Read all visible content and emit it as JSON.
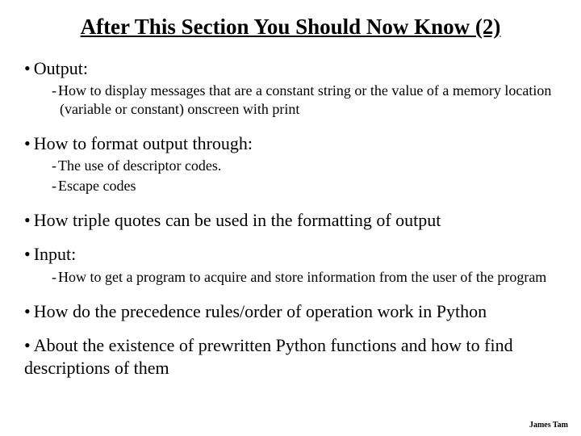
{
  "title": "After This Section You Should Now Know (2)",
  "b1": "Output:",
  "s1": "How to display messages that are a constant string or the value of a memory location (variable or constant) onscreen with print",
  "b2": "How to format output through:",
  "s2a": "The use of descriptor codes.",
  "s2b": "Escape codes",
  "b3": "How triple quotes can be used in the formatting of output",
  "b4": "Input:",
  "s4": "How to get a program to acquire and store information from the user of the program",
  "b5": "How do the precedence rules/order of operation work in Python",
  "b6": "About the existence of prewritten Python functions and how to find descriptions of them",
  "footer": "James Tam"
}
